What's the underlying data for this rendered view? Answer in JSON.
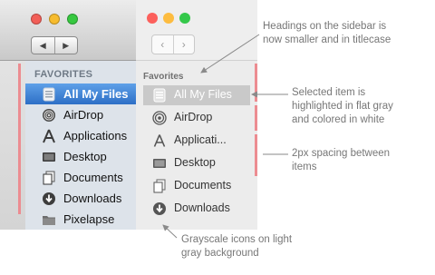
{
  "colors": {
    "old_selection": "#3b7fd6",
    "old_sidebar_bg": "#dde3ea",
    "new_selection": "#c9c9c9",
    "new_sidebar_bg": "#ececec",
    "marker": "#ec8c91",
    "annotation_text": "#777777"
  },
  "old_sidebar": {
    "heading": "FAVORITES",
    "items": [
      {
        "label": "All My Files",
        "icon": "all-files-icon",
        "selected": true
      },
      {
        "label": "AirDrop",
        "icon": "airdrop-icon",
        "selected": false
      },
      {
        "label": "Applications",
        "icon": "applications-icon",
        "selected": false
      },
      {
        "label": "Desktop",
        "icon": "desktop-icon",
        "selected": false
      },
      {
        "label": "Documents",
        "icon": "documents-icon",
        "selected": false
      },
      {
        "label": "Downloads",
        "icon": "downloads-icon",
        "selected": false
      },
      {
        "label": "Pixelapse",
        "icon": "folder-icon",
        "selected": false
      }
    ]
  },
  "new_sidebar": {
    "heading": "Favorites",
    "items": [
      {
        "label": "All My Files",
        "icon": "all-files-icon",
        "selected": true
      },
      {
        "label": "AirDrop",
        "icon": "airdrop-icon",
        "selected": false
      },
      {
        "label": "Applicati...",
        "icon": "applications-icon",
        "selected": false
      },
      {
        "label": "Desktop",
        "icon": "desktop-icon",
        "selected": false
      },
      {
        "label": "Documents",
        "icon": "documents-icon",
        "selected": false
      },
      {
        "label": "Downloads",
        "icon": "downloads-icon",
        "selected": false
      }
    ]
  },
  "annotations": {
    "headings": [
      "Headings on the sidebar is",
      "now smaller and in titlecase"
    ],
    "selected": [
      "Selected item is",
      "highlighted in flat gray",
      "and colored in white"
    ],
    "spacing": [
      "2px spacing between",
      "items"
    ],
    "icons": [
      "Grayscale icons on light",
      "gray background"
    ]
  }
}
